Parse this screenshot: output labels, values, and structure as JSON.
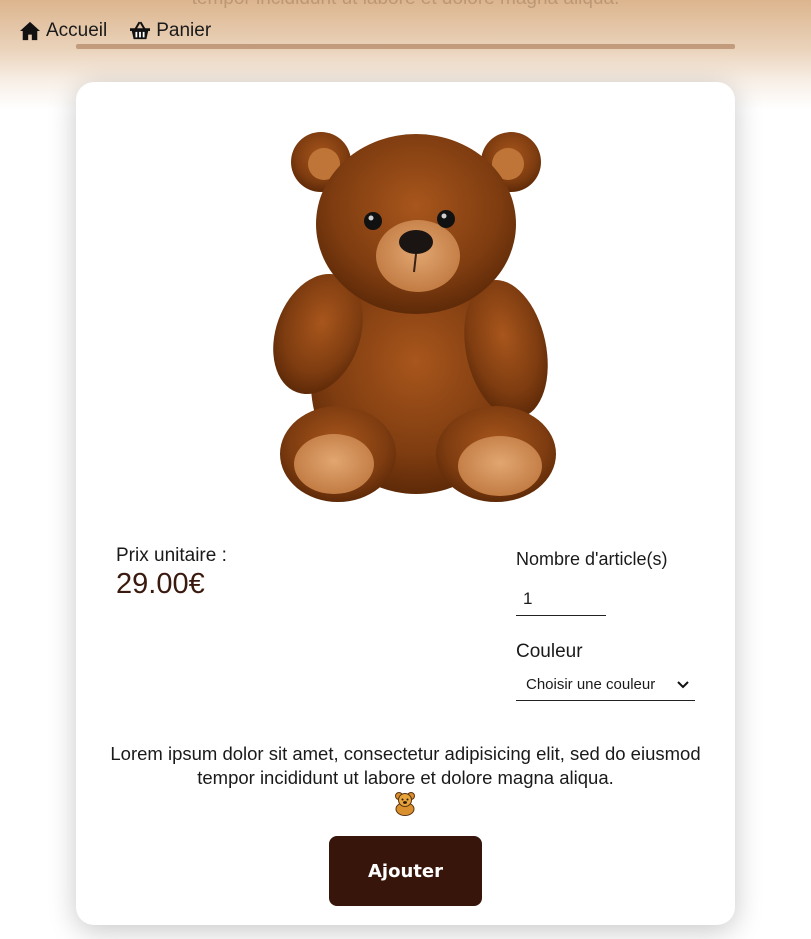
{
  "nav": {
    "home_label": "Accueil",
    "cart_label": "Panier"
  },
  "header": {
    "ghost_text": "tempor incididunt ut labore et dolore magna aliqua."
  },
  "product": {
    "price_label": "Prix unitaire :",
    "price_value": "29.00€",
    "quantity_label": "Nombre d'article(s)",
    "quantity_value": "1",
    "color_label": "Couleur",
    "color_select_value": "Choisir une couleur",
    "description": "Lorem ipsum dolor sit amet, consectetur adipisicing elit, sed do eiusmod tempor incididunt ut labore et dolore magna aliqua.",
    "add_button_label": "Ajouter"
  },
  "icons": {
    "home": "home-icon",
    "cart": "basket-icon",
    "dropdown": "chevron-down-icon",
    "bear": "teddy-bear-icon"
  },
  "colors": {
    "accent_dark_brown": "#37150b",
    "price_color": "#3a1a0e",
    "header_tan": "#dcb58e"
  }
}
